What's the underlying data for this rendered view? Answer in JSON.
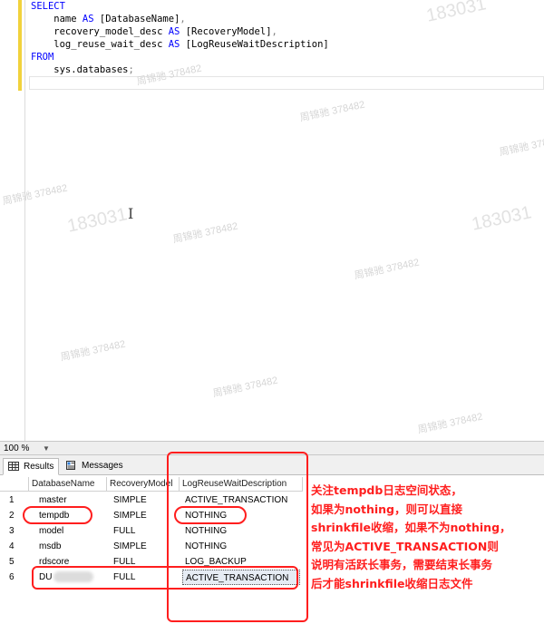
{
  "editor": {
    "code_lines": [
      [
        {
          "t": "SELECT",
          "c": "kw"
        }
      ],
      [
        {
          "t": "    name ",
          "c": ""
        },
        {
          "t": "AS",
          "c": "kw"
        },
        {
          "t": " [DatabaseName]",
          "c": ""
        },
        {
          "t": ",",
          "c": "gr"
        }
      ],
      [
        {
          "t": "    recovery_model_desc ",
          "c": ""
        },
        {
          "t": "AS",
          "c": "kw"
        },
        {
          "t": " [RecoveryModel]",
          "c": ""
        },
        {
          "t": ",",
          "c": "gr"
        }
      ],
      [
        {
          "t": "    log_reuse_wait_desc ",
          "c": ""
        },
        {
          "t": "AS",
          "c": "kw"
        },
        {
          "t": " [LogReuseWaitDescription]",
          "c": ""
        }
      ],
      [
        {
          "t": "FROM",
          "c": "kw"
        }
      ],
      [
        {
          "t": "    sys.databases",
          "c": ""
        },
        {
          "t": ";",
          "c": "gr"
        }
      ]
    ]
  },
  "watermarks": [
    "周锦驰 378482",
    "183031"
  ],
  "zoom": {
    "value": "100 %"
  },
  "results": {
    "tabs": [
      {
        "label": "Results",
        "icon": "grid-icon",
        "active": true
      },
      {
        "label": "Messages",
        "icon": "messages-icon",
        "active": false
      }
    ],
    "columns": [
      "DatabaseName",
      "RecoveryModel",
      "LogReuseWaitDescription"
    ],
    "rows": [
      {
        "num": "1",
        "db": "master",
        "rm": "SIMPLE",
        "lr": "ACTIVE_TRANSACTION"
      },
      {
        "num": "2",
        "db": "tempdb",
        "rm": "SIMPLE",
        "lr": "NOTHING"
      },
      {
        "num": "3",
        "db": "model",
        "rm": "FULL",
        "lr": "NOTHING"
      },
      {
        "num": "4",
        "db": "msdb",
        "rm": "SIMPLE",
        "lr": "NOTHING"
      },
      {
        "num": "5",
        "db": "rdscore",
        "rm": "FULL",
        "lr": "LOG_BACKUP"
      },
      {
        "num": "6",
        "db": "DU",
        "rm": "FULL",
        "lr": "ACTIVE_TRANSACTION"
      }
    ]
  },
  "annotation": {
    "color": "#ff1e1e",
    "lines": [
      "关注tempdb日志空间状态，",
      "如果为nothing，则可以直接",
      "shrinkfile收缩，如果不为nothing，",
      "常见为ACTIVE_TRANSACTION则",
      "说明有活跃长事务，需要结束长事务",
      "后才能shrinkfile收缩日志文件"
    ]
  }
}
